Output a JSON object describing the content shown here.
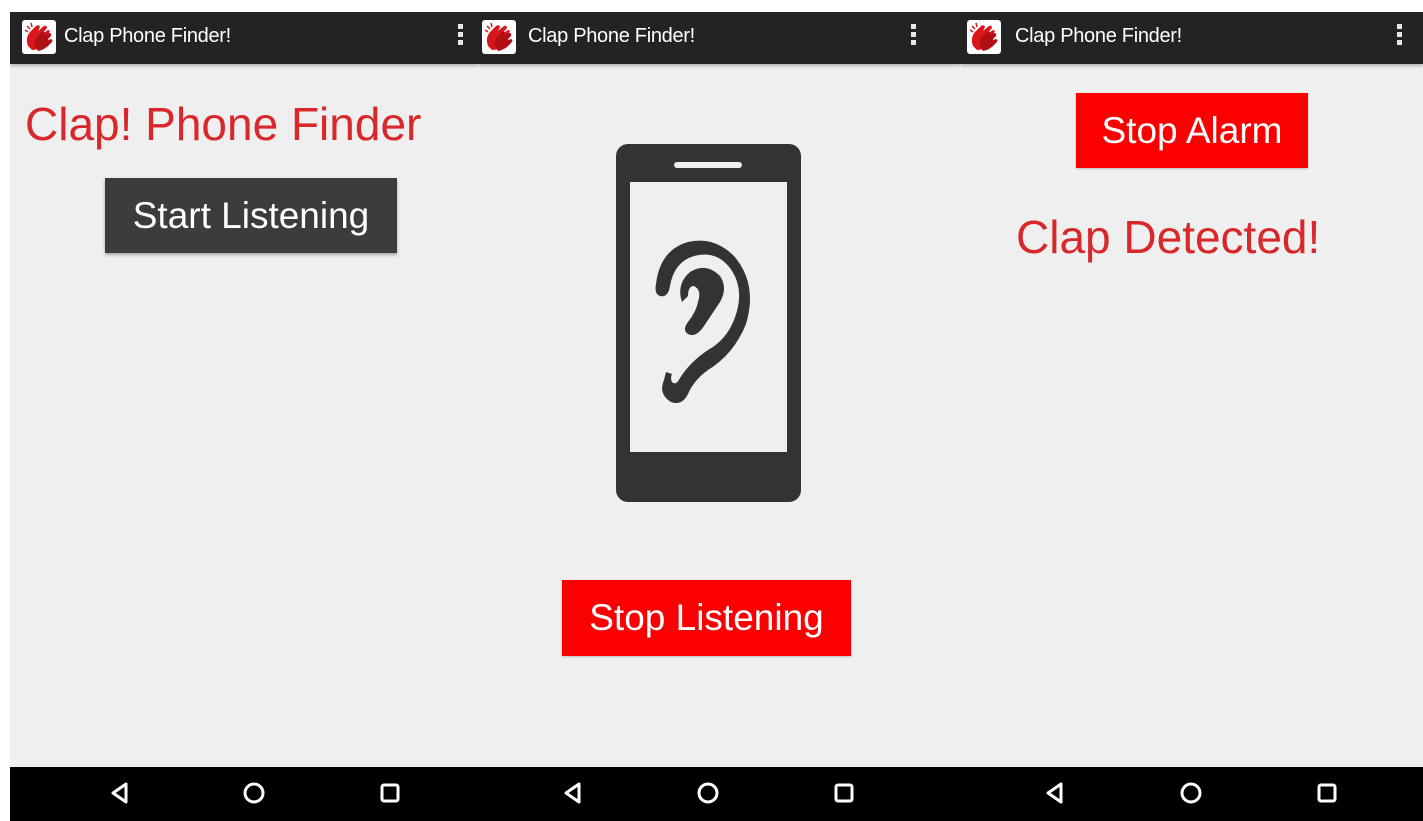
{
  "screens": [
    {
      "app_title": "Clap Phone Finder!",
      "heading": "Clap! Phone Finder",
      "button_label": "Start Listening"
    },
    {
      "app_title": "Clap Phone Finder!",
      "illustration_icon": "phone-ear-icon",
      "button_label": "Stop Listening"
    },
    {
      "app_title": "Clap Phone Finder!",
      "button_label": "Stop Alarm",
      "status_text": "Clap Detected!"
    }
  ],
  "nav_icons": [
    "back-icon",
    "home-icon",
    "recents-icon"
  ],
  "colors": {
    "accent_red": "#fa0000",
    "heading_red": "#d9282b",
    "dark_button": "#3c3c3c",
    "action_bar": "#232323",
    "background": "#efefef",
    "nav_bar": "#000000"
  }
}
